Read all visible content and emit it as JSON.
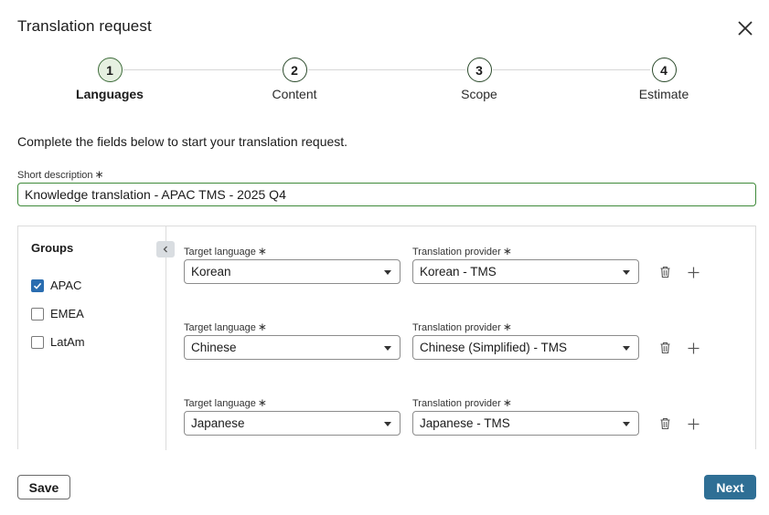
{
  "dialog": {
    "title": "Translation request"
  },
  "stepper": {
    "steps": [
      {
        "number": "1",
        "label": "Languages"
      },
      {
        "number": "2",
        "label": "Content"
      },
      {
        "number": "3",
        "label": "Scope"
      },
      {
        "number": "4",
        "label": "Estimate"
      }
    ],
    "active_step": 1
  },
  "intro_text": "Complete the fields below to start your translation request.",
  "short_description": {
    "label": "Short description",
    "required_mark": "∗",
    "value": "Knowledge translation - APAC TMS - 2025 Q4"
  },
  "groups": {
    "title": "Groups",
    "items": [
      {
        "label": "APAC",
        "checked": true
      },
      {
        "label": "EMEA",
        "checked": false
      },
      {
        "label": "LatAm",
        "checked": false
      }
    ]
  },
  "language_rows": [
    {
      "target_label": "Target language",
      "target_value": "Korean",
      "provider_label": "Translation provider",
      "provider_value": "Korean - TMS"
    },
    {
      "target_label": "Target language",
      "target_value": "Chinese",
      "provider_label": "Translation provider",
      "provider_value": "Chinese (Simplified) - TMS"
    },
    {
      "target_label": "Target language",
      "target_value": "Japanese",
      "provider_label": "Translation provider",
      "provider_value": "Japanese - TMS"
    }
  ],
  "required_mark": "∗",
  "footer": {
    "save_label": "Save",
    "next_label": "Next"
  },
  "colors": {
    "primary": "#2f6f95",
    "focus_border": "#3f8a3a",
    "checkbox": "#2a6db0",
    "active_step_fill": "#e6f0e1"
  }
}
